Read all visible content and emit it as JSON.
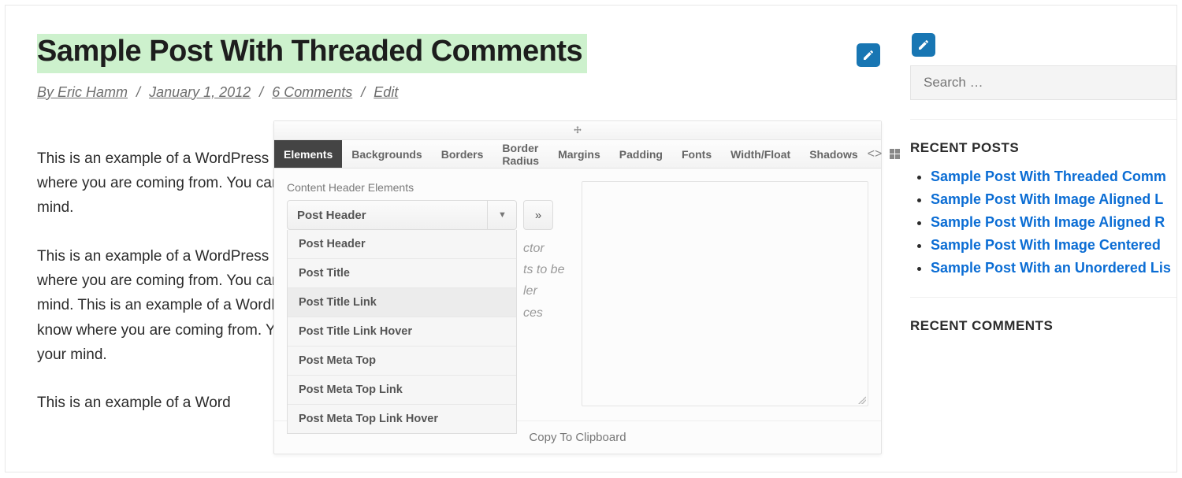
{
  "post": {
    "title": "Sample Post With Threaded Comments",
    "meta": {
      "by": "By Eric Hamm",
      "date": "January 1, 2012",
      "comments": "6 Comments",
      "edit": "Edit"
    },
    "paragraphs": [
      "This is an example of a WordPress post, you could edit this to put information about yourself or your site so readers know where you are coming from. You can create as many posts as you like in order to share with your readers what is on your mind.",
      "This is an example of a WordPress post, you could edit this to put information about yourself or your site so readers know where you are coming from. You can create as many posts as you like in order to share with your readers what is on your mind. This is an example of a WordPress post, you could edit this to put information about yourself or your site so readers know where you are coming from. You can create as many posts as you like in order to share with your readers what is on your mind.",
      "This is an example of a Word"
    ]
  },
  "sidebar": {
    "search_placeholder": "Search …",
    "recent_posts_heading": "RECENT POSTS",
    "recent_posts": [
      "Sample Post With Threaded Comm",
      "Sample Post With Image Aligned L",
      "Sample Post With Image Aligned R",
      "Sample Post With Image Centered",
      "Sample Post With an Unordered Lis"
    ],
    "recent_comments_heading": "RECENT COMMENTS"
  },
  "panel": {
    "tabs": [
      "Elements",
      "Backgrounds",
      "Borders",
      "Border Radius",
      "Margins",
      "Padding",
      "Fonts",
      "Width/Float",
      "Shadows"
    ],
    "body_label": "Content Header Elements",
    "selected": "Post Header",
    "options": [
      "Post Header",
      "Post Title",
      "Post Title Link",
      "Post Title Link Hover",
      "Post Meta Top",
      "Post Meta Top Link",
      "Post Meta Top Link Hover"
    ],
    "nav_btn": "»",
    "hints": [
      "ctor",
      "ts to be",
      "",
      "ler",
      "",
      "ces"
    ],
    "copy": "Copy To Clipboard"
  }
}
